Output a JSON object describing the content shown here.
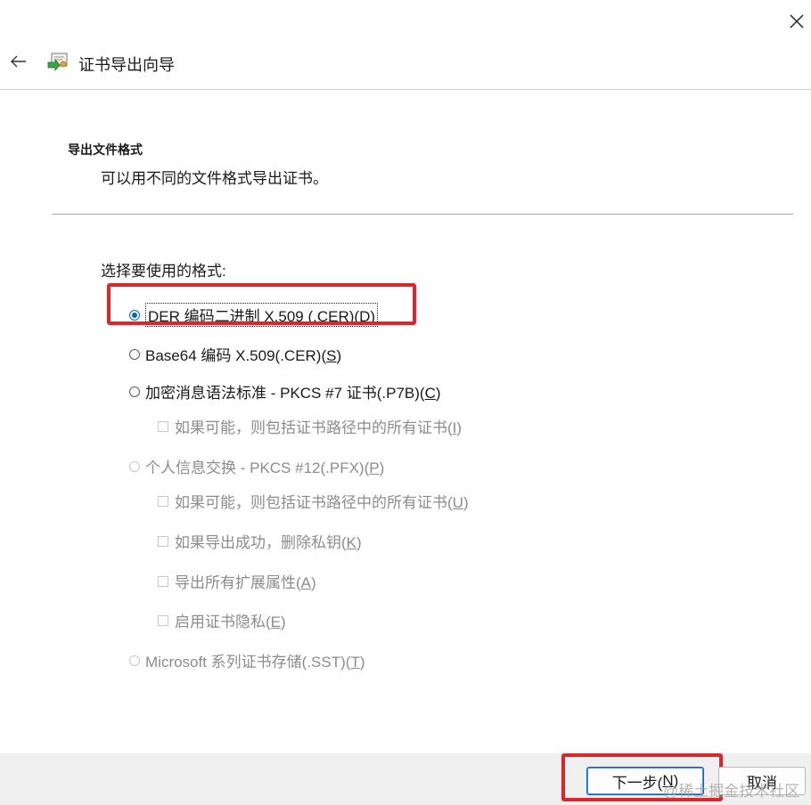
{
  "window": {
    "title": "证书导出向导"
  },
  "header": {
    "section_title": "导出文件格式",
    "section_desc": "可以用不同的文件格式导出证书。"
  },
  "form": {
    "choose_label": "选择要使用的格式:",
    "options": [
      {
        "label": "DER 编码二进制 X.509 (.CER)(",
        "key": "D",
        "close": ")",
        "type": "radio",
        "checked": true,
        "enabled": true
      },
      {
        "label": "Base64 编码 X.509(.CER)(",
        "key": "S",
        "close": ")",
        "type": "radio",
        "checked": false,
        "enabled": true
      },
      {
        "label": "加密消息语法标准 - PKCS #7 证书(.P7B)(",
        "key": "C",
        "close": ")",
        "type": "radio",
        "checked": false,
        "enabled": true
      },
      {
        "label": "如果可能，则包括证书路径中的所有证书(",
        "key": "I",
        "close": ")",
        "type": "checkbox",
        "checked": false,
        "enabled": false
      },
      {
        "label": "个人信息交换 - PKCS #12(.PFX)(",
        "key": "P",
        "close": ")",
        "type": "radio",
        "checked": false,
        "enabled": false
      },
      {
        "label": "如果可能，则包括证书路径中的所有证书(",
        "key": "U",
        "close": ")",
        "type": "checkbox",
        "checked": false,
        "enabled": false
      },
      {
        "label": "如果导出成功，删除私钥(",
        "key": "K",
        "close": ")",
        "type": "checkbox",
        "checked": false,
        "enabled": false
      },
      {
        "label": "导出所有扩展属性(",
        "key": "A",
        "close": ")",
        "type": "checkbox",
        "checked": false,
        "enabled": false
      },
      {
        "label": "启用证书隐私(",
        "key": "E",
        "close": ")",
        "type": "checkbox",
        "checked": false,
        "enabled": false
      },
      {
        "label": "Microsoft 系列证书存储(.SST)(",
        "key": "T",
        "close": ")",
        "type": "radio",
        "checked": false,
        "enabled": false
      }
    ]
  },
  "footer": {
    "next_label": "下一步(",
    "next_key": "N",
    "next_close": ")",
    "cancel_label": "取消",
    "watermark": "@稀土掘金技术社区"
  },
  "colors": {
    "highlight": "#e0242a",
    "accent": "#0a64c8"
  }
}
